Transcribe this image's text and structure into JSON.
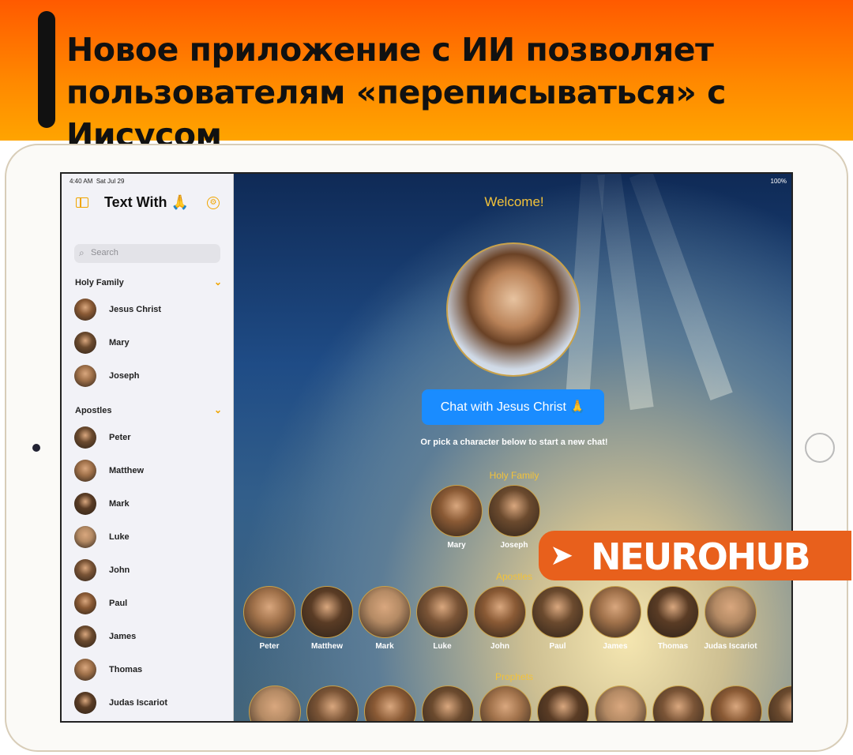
{
  "headline": "Новое приложение с ИИ позволяет пользователям «переписываться» с Иисусом",
  "watermark": "NEUROHUB",
  "status": {
    "time": "4:40 AM",
    "date": "Sat Jul 29",
    "battery": "100%"
  },
  "sidebar": {
    "title": "Text With 🙏",
    "search_placeholder": "Search",
    "sections": [
      {
        "title": "Holy Family",
        "items": [
          "Jesus Christ",
          "Mary",
          "Joseph"
        ]
      },
      {
        "title": "Apostles",
        "items": [
          "Peter",
          "Matthew",
          "Mark",
          "Luke",
          "John",
          "Paul",
          "James",
          "Thomas",
          "Judas Iscariot"
        ]
      }
    ]
  },
  "main": {
    "welcome": "Welcome!",
    "chat_button": "Chat with Jesus Christ 🙏",
    "pick_text": "Or pick a character below to start a new chat!",
    "groups": [
      {
        "title": "Holy Family",
        "characters": [
          "Mary",
          "Joseph"
        ]
      },
      {
        "title": "Apostles",
        "characters": [
          "Peter",
          "Matthew",
          "Mark",
          "Luke",
          "John",
          "Paul",
          "James",
          "Thomas",
          "Judas Iscariot"
        ]
      },
      {
        "title": "Prophets",
        "characters": [
          "",
          "",
          "",
          "",
          "",
          "",
          "",
          "",
          "",
          ""
        ]
      }
    ]
  },
  "colors": {
    "accent": "#f0a500",
    "button": "#1a8cff",
    "banner": "#ff7a00",
    "badge": "#e8601c"
  }
}
